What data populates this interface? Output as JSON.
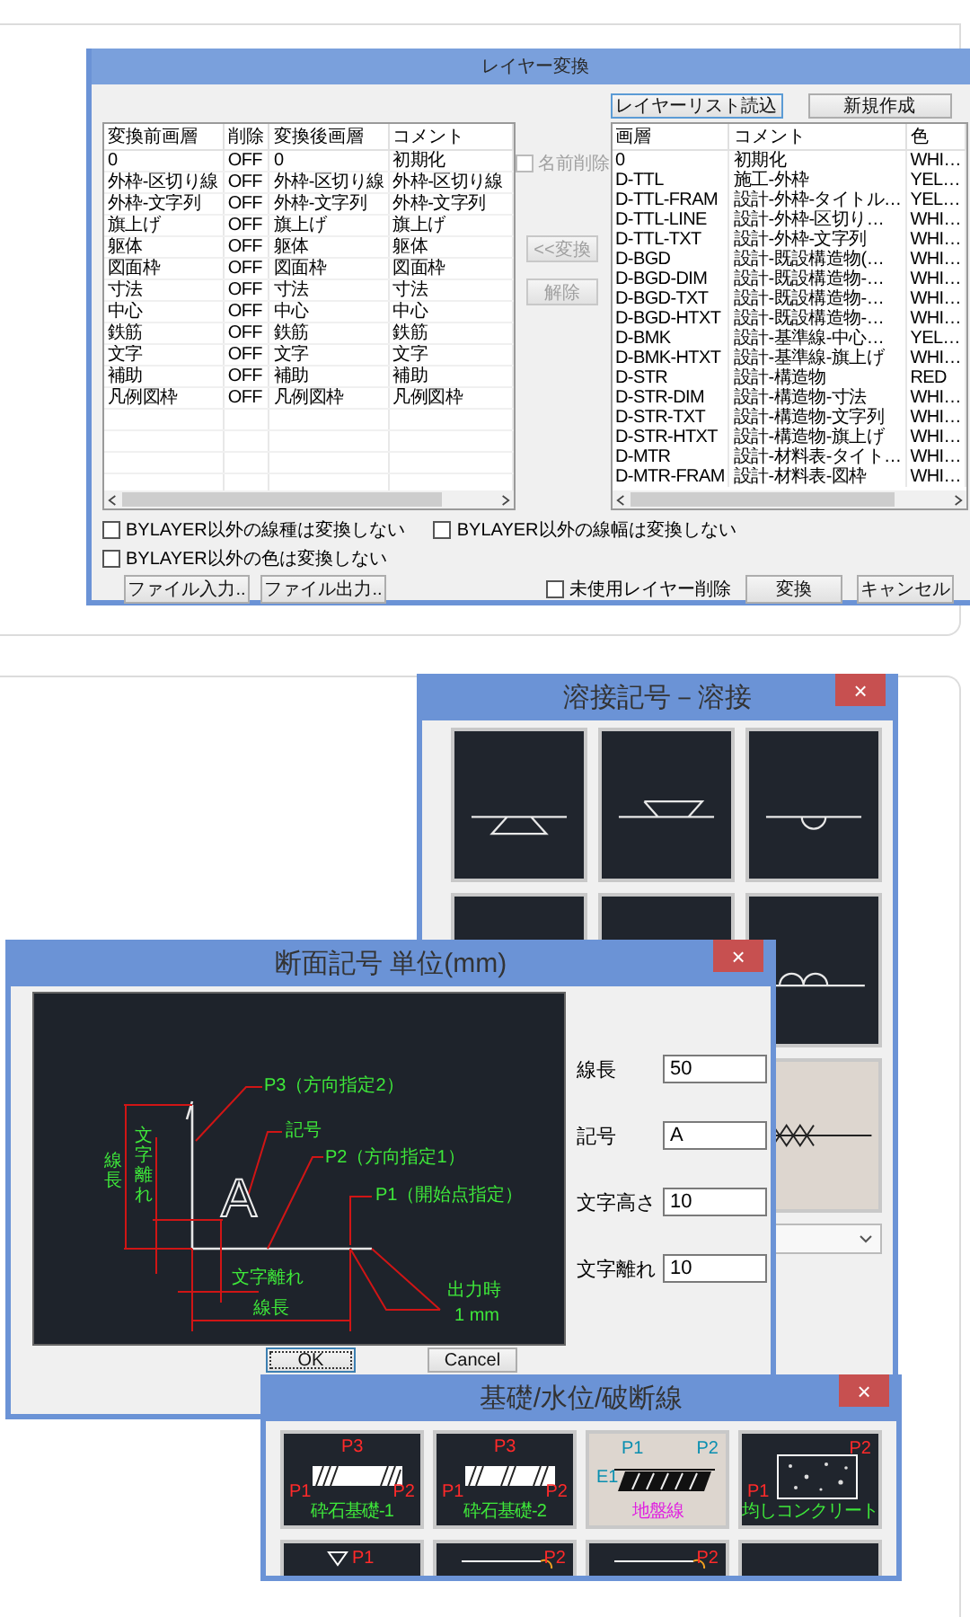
{
  "layer_dialog": {
    "title": "レイヤー変換",
    "list_load_button": "レイヤーリスト読込",
    "new_button": "新規作成",
    "source_table": {
      "columns": [
        "変換前画層",
        "削除",
        "変換後画層",
        "コメント"
      ],
      "rows": [
        [
          "0",
          "OFF",
          "0",
          "初期化"
        ],
        [
          "外枠-区切り線",
          "OFF",
          "外枠-区切り線",
          "外枠-区切り線"
        ],
        [
          "外枠-文字列",
          "OFF",
          "外枠-文字列",
          "外枠-文字列"
        ],
        [
          "旗上げ",
          "OFF",
          "旗上げ",
          "旗上げ"
        ],
        [
          "躯体",
          "OFF",
          "躯体",
          "躯体"
        ],
        [
          "図面枠",
          "OFF",
          "図面枠",
          "図面枠"
        ],
        [
          "寸法",
          "OFF",
          "寸法",
          "寸法"
        ],
        [
          "中心",
          "OFF",
          "中心",
          "中心"
        ],
        [
          "鉄筋",
          "OFF",
          "鉄筋",
          "鉄筋"
        ],
        [
          "文字",
          "OFF",
          "文字",
          "文字"
        ],
        [
          "補助",
          "OFF",
          "補助",
          "補助"
        ],
        [
          "凡例図枠",
          "OFF",
          "凡例図枠",
          "凡例図枠"
        ]
      ]
    },
    "name_delete": {
      "label": "名前削除",
      "checked": false,
      "disabled": true
    },
    "middle_buttons": [
      {
        "label": "<<変換",
        "disabled": true
      },
      {
        "label": "解除",
        "disabled": true
      }
    ],
    "target_table": {
      "columns": [
        "画層",
        "コメント",
        "色"
      ],
      "rows": [
        [
          "0",
          "初期化",
          "WHI…"
        ],
        [
          "D-TTL",
          "施工-外枠",
          "YEL…"
        ],
        [
          "D-TTL-FRAM",
          "設計-外枠-タイトル…",
          "YEL…"
        ],
        [
          "D-TTL-LINE",
          "設計-外枠-区切り…",
          "WHI…"
        ],
        [
          "D-TTL-TXT",
          "設計-外枠-文字列",
          "WHI…"
        ],
        [
          "D-BGD",
          "設計-既設構造物(…",
          "WHI…"
        ],
        [
          "D-BGD-DIM",
          "設計-既設構造物-…",
          "WHI…"
        ],
        [
          "D-BGD-TXT",
          "設計-既設構造物-…",
          "WHI…"
        ],
        [
          "D-BGD-HTXT",
          "設計-既設構造物-…",
          "WHI…"
        ],
        [
          "D-BMK",
          "設計-基準線-中心…",
          "YEL…"
        ],
        [
          "D-BMK-HTXT",
          "設計-基準線-旗上げ",
          "WHI…"
        ],
        [
          "D-STR",
          "設計-構造物",
          "RED"
        ],
        [
          "D-STR-DIM",
          "設計-構造物-寸法",
          "WHI…"
        ],
        [
          "D-STR-TXT",
          "設計-構造物-文字列",
          "WHI…"
        ],
        [
          "D-STR-HTXT",
          "設計-構造物-旗上げ",
          "WHI…"
        ],
        [
          "D-MTR",
          "設計-材料表-タイト…",
          "WHI…"
        ],
        [
          "D-MTR-FRAM",
          "設計-材料表-図枠",
          "WHI…"
        ]
      ]
    },
    "option_rows": [
      [
        {
          "label": "BYLAYER以外の線種は変換しない",
          "checked": false
        },
        {
          "label": "BYLAYER以外の線幅は変換しない",
          "checked": false
        }
      ],
      [
        {
          "label": "BYLAYER以外の色は変換しない",
          "checked": false
        }
      ]
    ],
    "file_buttons": [
      "ファイル入力..",
      "ファイル出力.."
    ],
    "unused_delete": {
      "label": "未使用レイヤー削除",
      "checked": false
    },
    "convert_button": "変換",
    "cancel_button": "キャンセル"
  },
  "weld_dialog": {
    "title": "溶接記号－溶接",
    "close": "×",
    "tile_rows": [
      [
        {
          "kind": "groove-below",
          "selected": false
        },
        {
          "kind": "groove-above",
          "selected": false
        },
        {
          "kind": "bead-below",
          "selected": false
        }
      ],
      [
        {
          "selected": false
        },
        {
          "selected": false
        },
        {
          "kind": "double-bead",
          "selected": false
        }
      ],
      [
        {
          "kind": "zigzag",
          "selected": true
        }
      ]
    ]
  },
  "section_dialog": {
    "title": "断面記号 単位(mm)",
    "close": "×",
    "diagram": {
      "p3": "P3（方向指定2）",
      "symbol_note": "記号",
      "p2": "P2（方向指定1）",
      "p1": "P1（開始点指定）",
      "length_vertical": "線長",
      "offset_vertical": "文字離れ",
      "offset": "文字離れ",
      "length": "線長",
      "output_note": "出力時",
      "output_size": "1 mm",
      "symbol": "A"
    },
    "fields": [
      {
        "label": "線長",
        "value": "50"
      },
      {
        "label": "記号",
        "value": "A"
      },
      {
        "label": "文字高さ",
        "value": "10"
      },
      {
        "label": "文字離れ",
        "value": "10"
      }
    ],
    "buttons": [
      "OK",
      "Cancel"
    ]
  },
  "foundation_dialog": {
    "title": "基礎/水位/破断線",
    "close": "×",
    "tiles": [
      {
        "kind": "gravel-1",
        "selected": false,
        "labels": [
          {
            "text": "P3",
            "color": "#ff2a2a"
          },
          {
            "text": "P1",
            "color": "#ff2a2a"
          },
          {
            "text": "P2",
            "color": "#ff2a2a"
          }
        ],
        "caption": "砕石基礎-1"
      },
      {
        "kind": "gravel-2",
        "selected": false,
        "labels": [
          {
            "text": "P3",
            "color": "#ff2a2a"
          },
          {
            "text": "P1",
            "color": "#ff2a2a"
          },
          {
            "text": "P2",
            "color": "#ff2a2a"
          }
        ],
        "caption": "砕石基礎-2"
      },
      {
        "kind": "ground",
        "selected": true,
        "labels": [
          {
            "text": "P1",
            "color": "#0a8fb0"
          },
          {
            "text": "P2",
            "color": "#0a8fb0"
          },
          {
            "text": "E1",
            "color": "#0a8fb0"
          }
        ],
        "caption": "地盤線"
      },
      {
        "kind": "concrete",
        "selected": false,
        "labels": [
          {
            "text": "P2",
            "color": "#ff2a2a"
          },
          {
            "text": "P1",
            "color": "#ff2a2a"
          }
        ],
        "caption": "均しコンクリート"
      },
      {
        "kind": "water",
        "selected": false,
        "labels": [
          {
            "text": "P1",
            "color": "#ff2a2a"
          }
        ]
      },
      {
        "kind": "break-line",
        "selected": false,
        "labels": [
          {
            "text": "P2",
            "color": "#ff2a2a"
          }
        ]
      },
      {
        "kind": "break-line",
        "selected": false,
        "labels": [
          {
            "text": "P2",
            "color": "#ff2a2a"
          }
        ]
      },
      {
        "selected": false
      }
    ]
  }
}
